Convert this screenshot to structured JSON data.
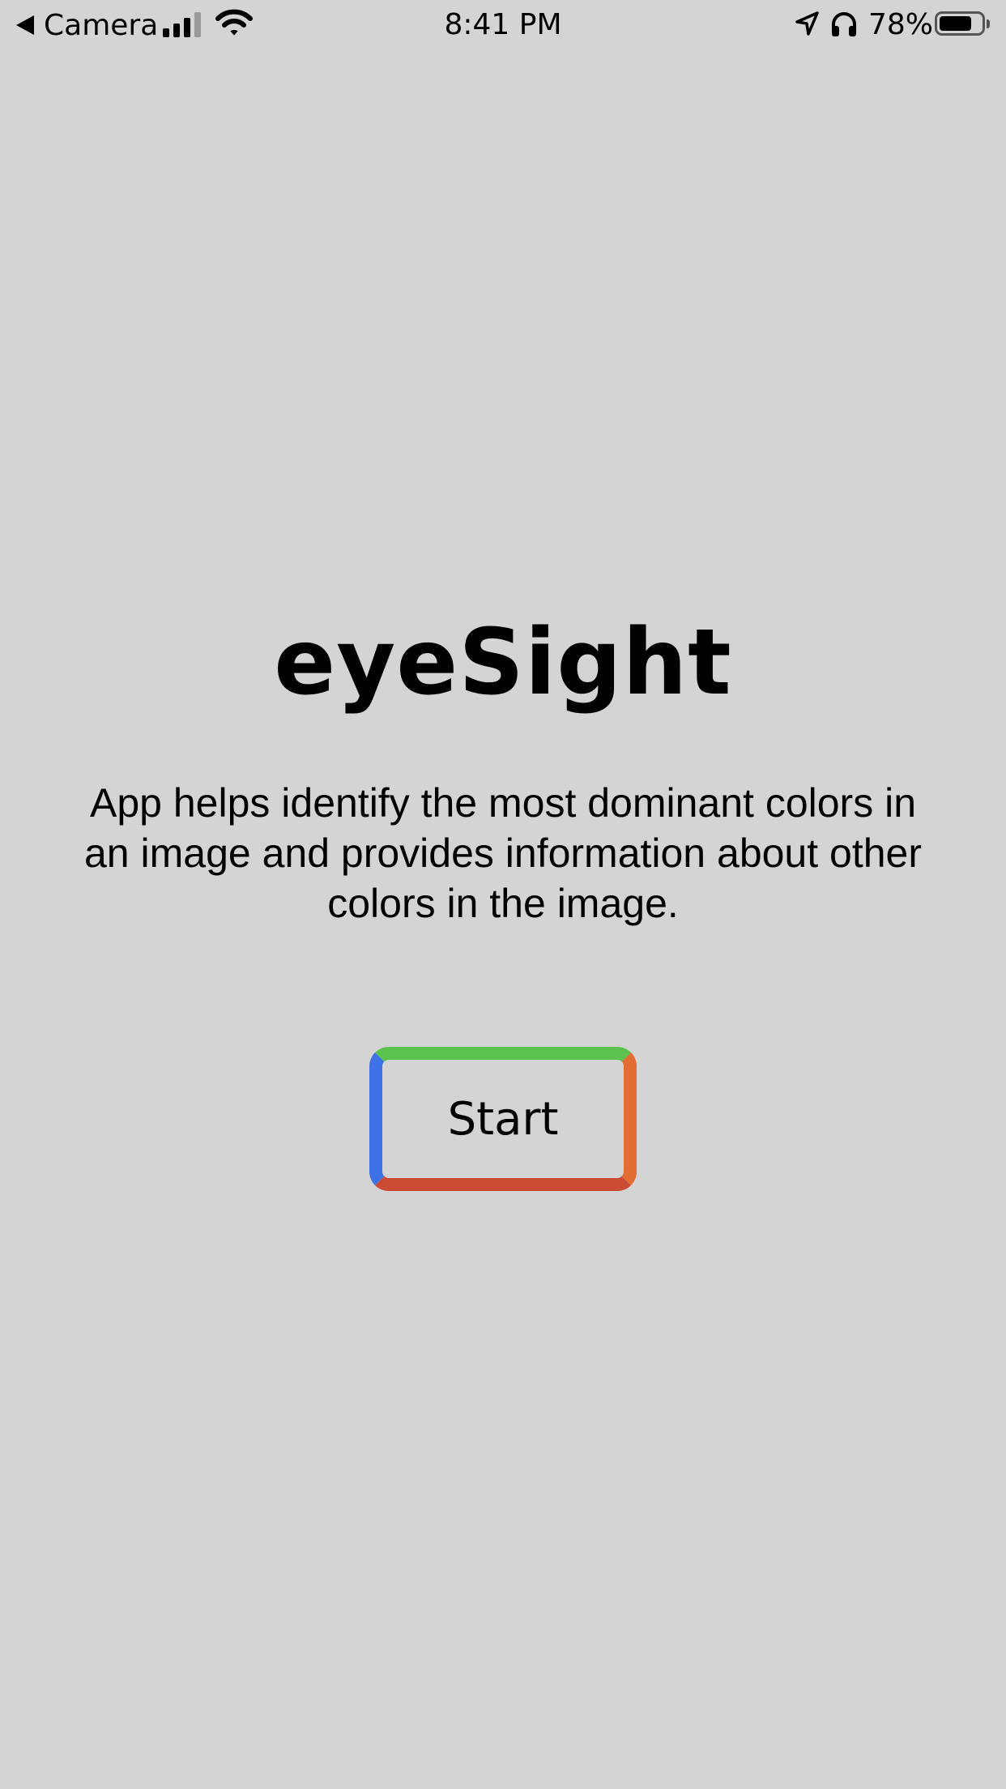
{
  "status_bar": {
    "back_label": "Camera",
    "time": "8:41 PM",
    "battery_percent": "78%",
    "battery_level": 0.78,
    "signal_bars_active": 3,
    "signal_bars_total": 4,
    "icons": [
      "back-arrow-icon",
      "signal-icon",
      "wifi-icon",
      "location-icon",
      "headphones-icon",
      "battery-icon"
    ]
  },
  "main": {
    "title": "eyeSight",
    "description": "App helps identify the most dominant colors in an image and provides information about other colors in the image.",
    "start_button": {
      "label": "Start",
      "border_colors": {
        "top": "#5cc24e",
        "right": "#e36e33",
        "bottom": "#cc4b35",
        "left": "#3f72e6"
      }
    }
  },
  "theme": {
    "background": "#d4d4d4",
    "text": "#000000"
  }
}
